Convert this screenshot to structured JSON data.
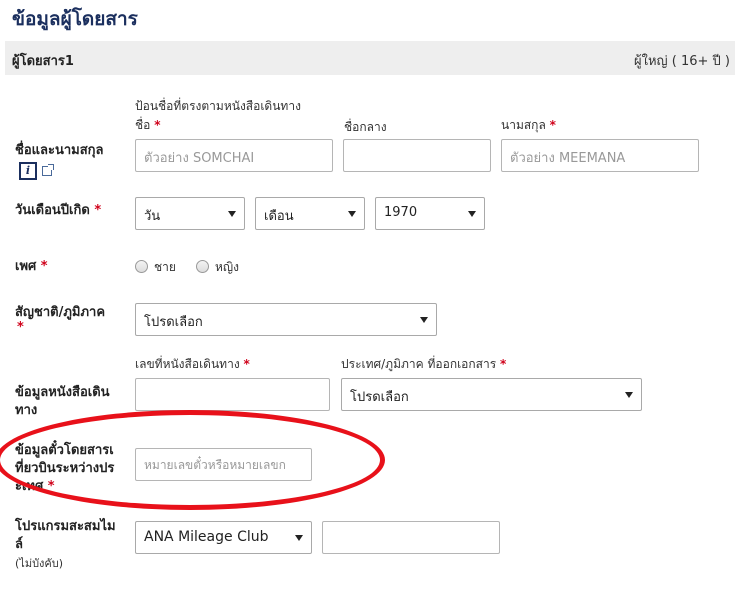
{
  "section_title": "ข้อมูลผู้โดยสาร",
  "passenger": {
    "name": "ผู้โดยสาร1",
    "type": "ผู้ใหญ่ ( 16+ ปี )"
  },
  "required_mark": "*",
  "name_section": {
    "label": "ชื่อและนามสกุล",
    "hint": "ป้อนชื่อที่ตรงตามหนังสือเดินทาง",
    "info_glyph": "i",
    "first": {
      "label": "ชื่อ",
      "placeholder": "ตัวอย่าง SOMCHAI"
    },
    "middle": {
      "label": "ชื่อกลาง",
      "placeholder": ""
    },
    "last": {
      "label": "นามสกุล",
      "placeholder": "ตัวอย่าง MEEMANA"
    }
  },
  "dob": {
    "label": "วันเดือนปีเกิด",
    "day": "วัน",
    "month": "เดือน",
    "year": "1970"
  },
  "gender": {
    "label": "เพศ",
    "male": "ชาย",
    "female": "หญิง"
  },
  "nationality": {
    "label": "สัญชาติ/ภูมิภาค",
    "value": "โปรดเลือก"
  },
  "passport": {
    "label_line1": "ข้อมูลหนังสือเดิน",
    "label_line2": "ทาง",
    "number_label": "เลขที่หนังสือเดินทาง",
    "country_label": "ประเทศ/ภูมิภาค ที่ออกเอกสาร",
    "country_value": "โปรดเลือก"
  },
  "ticket": {
    "label_line1": "ข้อมูลตั๋วโดยสารเ",
    "label_line2": "ที่ยวบินระหว่างปร",
    "label_line3": "ะเทศ",
    "placeholder": "หมายเลขตั๋วหรือหมายเลขก"
  },
  "mileage": {
    "label_line1": "โปรแกรมสะสมไม",
    "label_line2": "ล์",
    "optional": "(ไม่บังคับ)",
    "program": "ANA Mileage Club"
  },
  "colors": {
    "accent": "#1b2f5e",
    "required": "#d0021b",
    "highlight_circle": "#e8111a"
  },
  "icons": {
    "info": "info-icon",
    "external": "external-link-icon",
    "dropdown": "chevron-down-icon"
  }
}
